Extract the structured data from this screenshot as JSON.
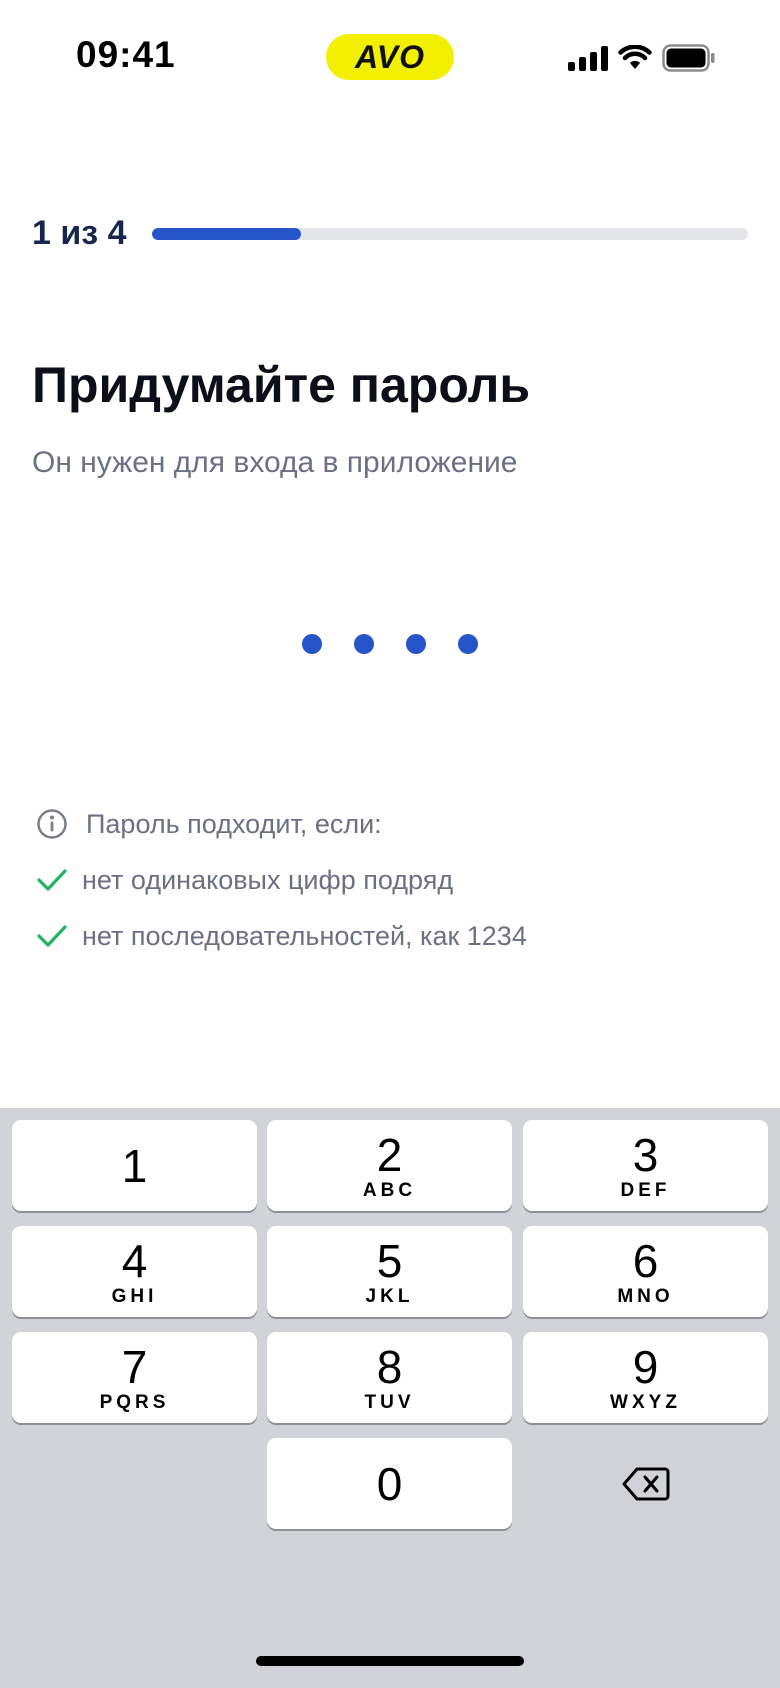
{
  "status_bar": {
    "time": "09:41",
    "brand": "AVO",
    "brand_color": "#f2f000",
    "icons": [
      "signal-icon",
      "wifi-icon",
      "battery-icon"
    ]
  },
  "progress": {
    "label": "1 из 4",
    "current_step": 1,
    "total_steps": 4,
    "fraction": 0.25,
    "color": "#2555c8"
  },
  "title": "Придумайте пароль",
  "subtitle": "Он нужен для входа в приложение",
  "pin": {
    "length": 4,
    "filled": 4
  },
  "rules": {
    "header": "Пароль подходит, если:",
    "items": [
      {
        "text": "нет одинаковых цифр подряд",
        "ok": true
      },
      {
        "text": "нет последовательностей, как 1234",
        "ok": true
      }
    ],
    "ok_color": "#22b35e"
  },
  "keypad": {
    "keys": [
      {
        "digit": "1",
        "letters": ""
      },
      {
        "digit": "2",
        "letters": "ABC"
      },
      {
        "digit": "3",
        "letters": "DEF"
      },
      {
        "digit": "4",
        "letters": "GHI"
      },
      {
        "digit": "5",
        "letters": "JKL"
      },
      {
        "digit": "6",
        "letters": "MNO"
      },
      {
        "digit": "7",
        "letters": "PQRS"
      },
      {
        "digit": "8",
        "letters": "TUV"
      },
      {
        "digit": "9",
        "letters": "WXYZ"
      },
      {
        "digit": "0",
        "letters": ""
      }
    ],
    "backspace_icon": "backspace-icon"
  }
}
